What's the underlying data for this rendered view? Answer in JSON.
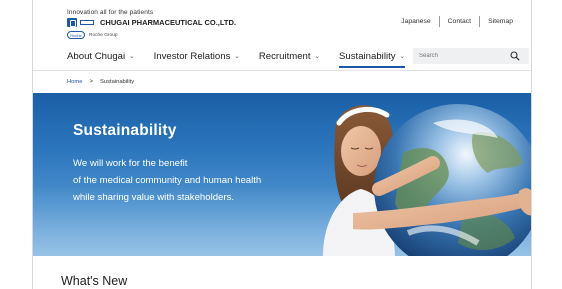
{
  "header": {
    "tagline": "Innovation all for the patients",
    "company_name": "CHUGAI PHARMACEUTICAL CO.,LTD.",
    "group_badge": "Roche",
    "group_name": "Roche Group",
    "brand_color": "#1e57a8"
  },
  "utility_links": [
    "Japanese",
    "Contact",
    "Sitemap"
  ],
  "nav": {
    "items": [
      {
        "label": "About Chugai"
      },
      {
        "label": "Investor Relations"
      },
      {
        "label": "Recruitment"
      },
      {
        "label": "Sustainability"
      }
    ],
    "active": "Sustainability"
  },
  "search": {
    "placeholder": "Search",
    "icon": "search-icon"
  },
  "breadcrumb": {
    "home": "Home",
    "separator": ">",
    "current": "Sustainability"
  },
  "hero": {
    "title": "Sustainability",
    "lines": [
      "We will work for the benefit",
      "of the medical community and human health",
      "while sharing value with stakeholders."
    ]
  },
  "section": {
    "title": "What's New"
  }
}
